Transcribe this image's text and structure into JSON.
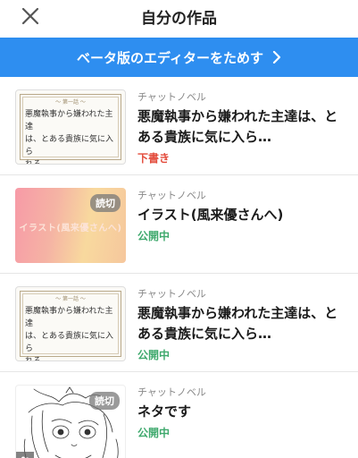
{
  "header": {
    "title": "自分の作品",
    "close_icon": "close-icon"
  },
  "banner": {
    "label": "ベータ版のエディターをためす",
    "icon": "chevron-right-icon",
    "color": "#2e8ef0"
  },
  "works": [
    {
      "genre": "チャットノベル",
      "title": "悪魔執事から嫌われた主達は、とある貴族に気に入ら…",
      "status": "下書き",
      "status_color": "#e34b3b",
      "cover": {
        "type": "title-card",
        "ornament": "～ 第一話 ～",
        "line1": "悪魔執事から嫌われた主達",
        "line2": "は、とある貴族に気に入ら",
        "line3": "れる"
      }
    },
    {
      "genre": "チャットノベル",
      "title": "イラスト(風来優さんへ)",
      "status": "公開中",
      "status_color": "#3fa96d",
      "cover": {
        "type": "gradient",
        "text": "イラスト(風来優さんへ)",
        "badge": "読切"
      }
    },
    {
      "genre": "チャットノベル",
      "title": "悪魔執事から嫌われた主達は、とある貴族に気に入ら…",
      "status": "公開中",
      "status_color": "#3fa96d",
      "cover": {
        "type": "title-card",
        "ornament": "～ 第一話 ～",
        "line1": "悪魔執事から嫌われた主達",
        "line2": "は、とある貴族に気に入ら",
        "line3": "れる"
      }
    },
    {
      "genre": "チャットノベル",
      "title": "ネタです",
      "status": "公開中",
      "status_color": "#3fa96d",
      "cover": {
        "type": "sketch",
        "badge": "読切",
        "icon": "user-group-icon"
      }
    }
  ]
}
